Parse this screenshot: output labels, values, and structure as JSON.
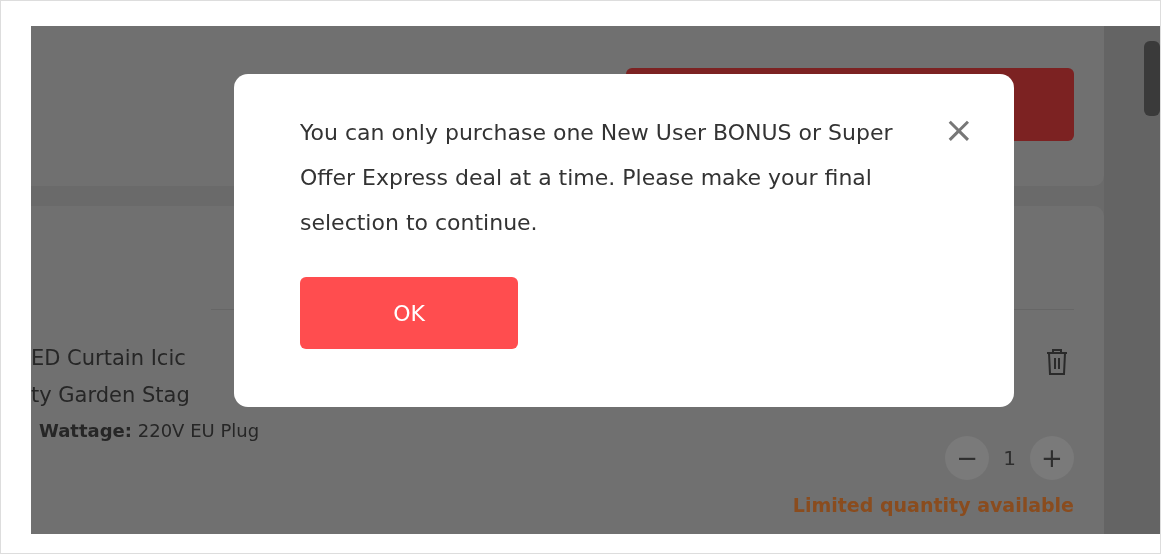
{
  "background": {
    "product": {
      "title_lines": [
        "ED Curtain Icic",
        "ty Garden Stag"
      ],
      "attribute_label": "Wattage:",
      "attribute_value": "220V EU Plug",
      "quantity": "1",
      "minus": "−",
      "plus": "+",
      "stock_note": "Limited quantity available"
    }
  },
  "dialog": {
    "message": "You can only purchase one New User BONUS or Super Offer Express deal at a time. Please make your final selection to continue.",
    "close": "×",
    "button": "OK"
  }
}
